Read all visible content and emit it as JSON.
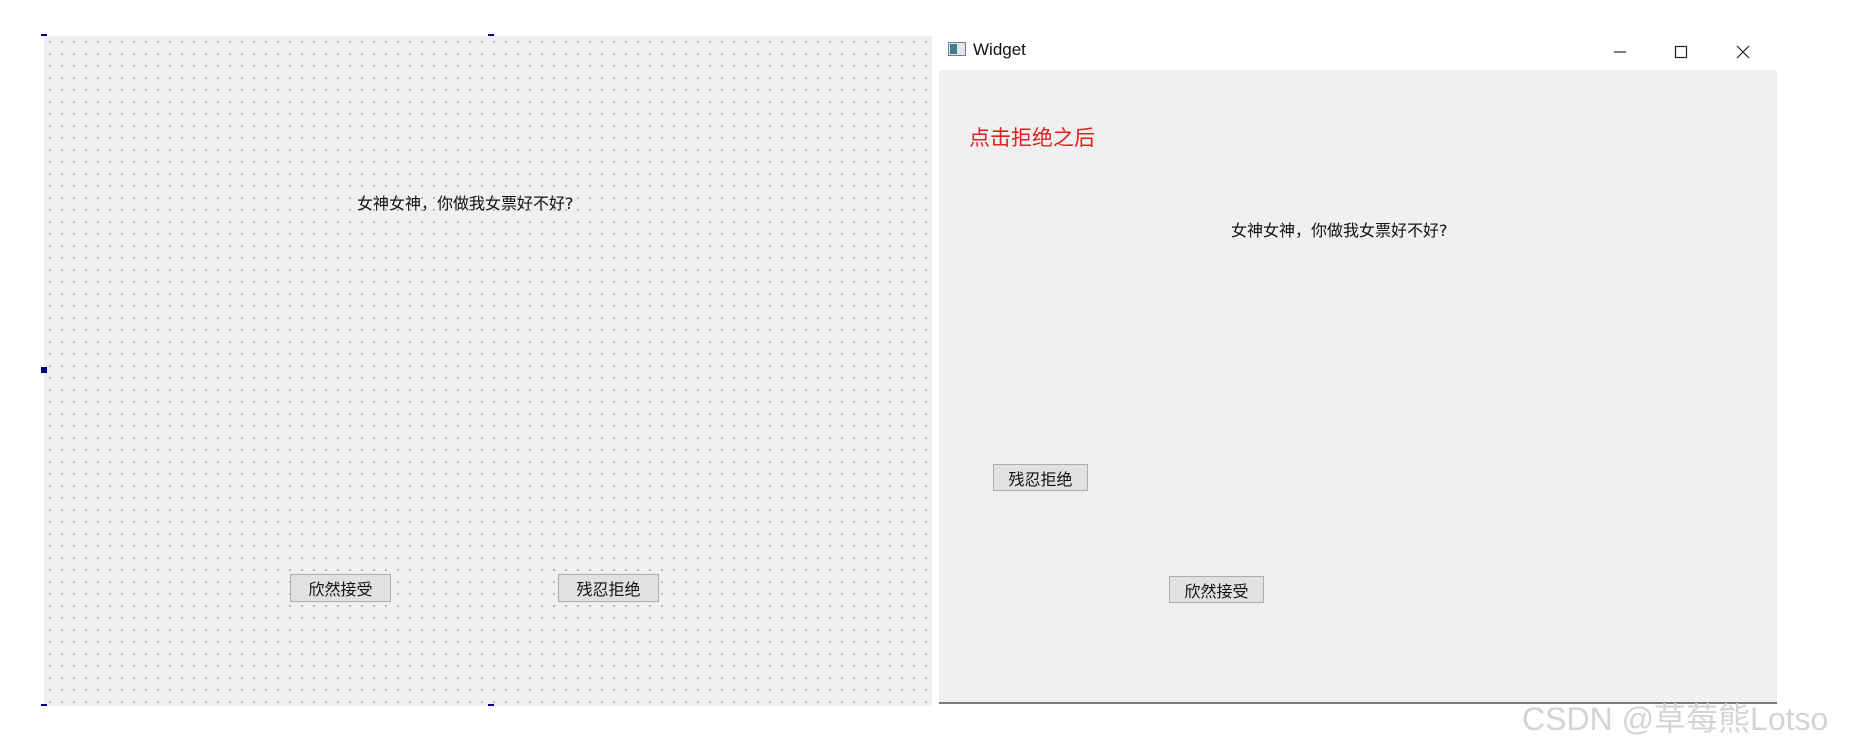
{
  "designer": {
    "label_text": "女神女神，你做我女票好不好?",
    "accept_button": "欣然接受",
    "reject_button": "残忍拒绝"
  },
  "widget": {
    "window_title": "Widget",
    "icons": {
      "app": "widget-app-icon",
      "minimize": "minimize-icon",
      "maximize": "maximize-icon",
      "close": "close-icon"
    },
    "annotation": "点击拒绝之后",
    "label_text": "女神女神，你做我女票好不好?",
    "reject_button": "残忍拒绝",
    "accept_button": "欣然接受"
  },
  "colors": {
    "annotation_red": "#e02020",
    "selection_handle": "#000080",
    "form_background": "#f0f0f0"
  },
  "watermark": "CSDN @草莓熊Lotso"
}
